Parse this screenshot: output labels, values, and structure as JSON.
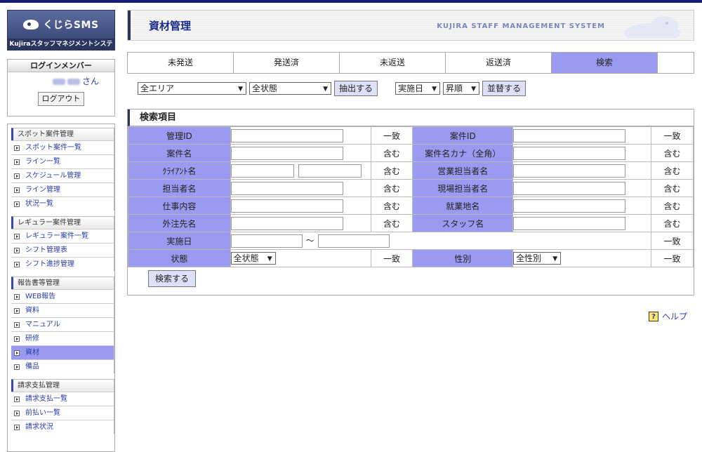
{
  "brand": {
    "name": "くじらSMS",
    "subtitle": "Kujiraスタッフマネジメントシステム"
  },
  "login": {
    "title": "ログインメンバー",
    "user_suffix": "さん",
    "logout_label": "ログアウト"
  },
  "sidebar": {
    "groups": [
      {
        "title": "スポット案件管理",
        "items": [
          "スポット案件一覧",
          "ライン一覧",
          "スケジュール管理",
          "ライン管理",
          "状況一覧"
        ]
      },
      {
        "title": "レギュラー案件管理",
        "items": [
          "レギュラー案件一覧",
          "シフト管理表",
          "シフト進捗管理"
        ]
      },
      {
        "title": "報告書等管理",
        "items": [
          "WEB報告",
          "資料",
          "マニュアル",
          "研修",
          "資材",
          "備品"
        ]
      },
      {
        "title": "請求支払管理",
        "items": [
          "請求支払一覧",
          "前払い一覧",
          "請求状況"
        ]
      }
    ],
    "active_item": "資材"
  },
  "header": {
    "title": "資材管理",
    "system_name": "KUJIRA STAFF MANAGEMENT SYSTEM"
  },
  "tabs": [
    "未発送",
    "発送済",
    "未返送",
    "返送済",
    "検索"
  ],
  "active_tab": "検索",
  "filter": {
    "area": "全エリア",
    "status": "全状態",
    "extract_label": "抽出する",
    "sort_field": "実施日",
    "sort_order": "昇順",
    "sort_label": "並替する"
  },
  "search": {
    "title": "検索項目",
    "rows": [
      {
        "l1": "管理ID",
        "m1": "一致",
        "l2": "案件ID",
        "m2": "一致"
      },
      {
        "l1": "案件名",
        "m1": "含む",
        "l2": "案件名カナ（全角）",
        "m2": "含む"
      },
      {
        "l1": "ｸﾗｲｱﾝﾄ名",
        "m1": "含む",
        "l2": "営業担当者名",
        "m2": "含む"
      },
      {
        "l1": "担当者名",
        "m1": "含む",
        "l2": "現場担当者名",
        "m2": "含む"
      },
      {
        "l1": "仕事内容",
        "m1": "含む",
        "l2": "就業地名",
        "m2": "含む"
      },
      {
        "l1": "外注先名",
        "m1": "含む",
        "l2": "スタッフ名",
        "m2": "含む"
      }
    ],
    "date_label": "実施日",
    "date_sep": "～",
    "date_match": "一致",
    "state_label": "状態",
    "state_value": "全状態",
    "state_match": "一致",
    "gender_label": "性別",
    "gender_value": "全性別",
    "gender_match": "一致",
    "submit_label": "検索する"
  },
  "help_label": "ヘルプ",
  "colors": {
    "accent": "#9a9af0",
    "navy": "#2a3560",
    "link": "#2a3ca8"
  }
}
